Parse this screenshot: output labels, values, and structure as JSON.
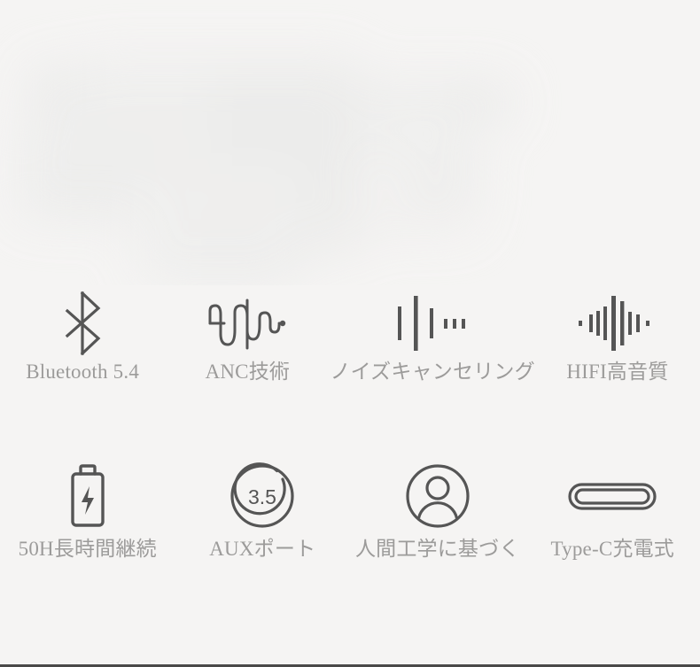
{
  "page": {
    "background_color": "#f5f4f3",
    "icon_color": "#555555",
    "label_color": "#9c9b9a",
    "bottom_rule_color": "#2c2a29"
  },
  "hero": {
    "description": "blurred product photograph area"
  },
  "features": {
    "row1": [
      {
        "icon": "bluetooth-icon",
        "label": "Bluetooth 5.4"
      },
      {
        "icon": "anc-waveform-icon",
        "label": "ANC技術"
      },
      {
        "icon": "noise-cancel-bars-icon",
        "label": "ノイズキャンセリング"
      },
      {
        "icon": "hifi-waveform-icon",
        "label": "HIFI高音質"
      }
    ],
    "row2": [
      {
        "icon": "battery-charge-icon",
        "label": "50H長時間継続"
      },
      {
        "icon": "aux-35mm-icon",
        "label": "AUXポート",
        "icon_text": "3.5"
      },
      {
        "icon": "person-ergonomic-icon",
        "label": "人間工学に基づく"
      },
      {
        "icon": "usb-type-c-icon",
        "label": "Type-C充電式"
      }
    ]
  }
}
